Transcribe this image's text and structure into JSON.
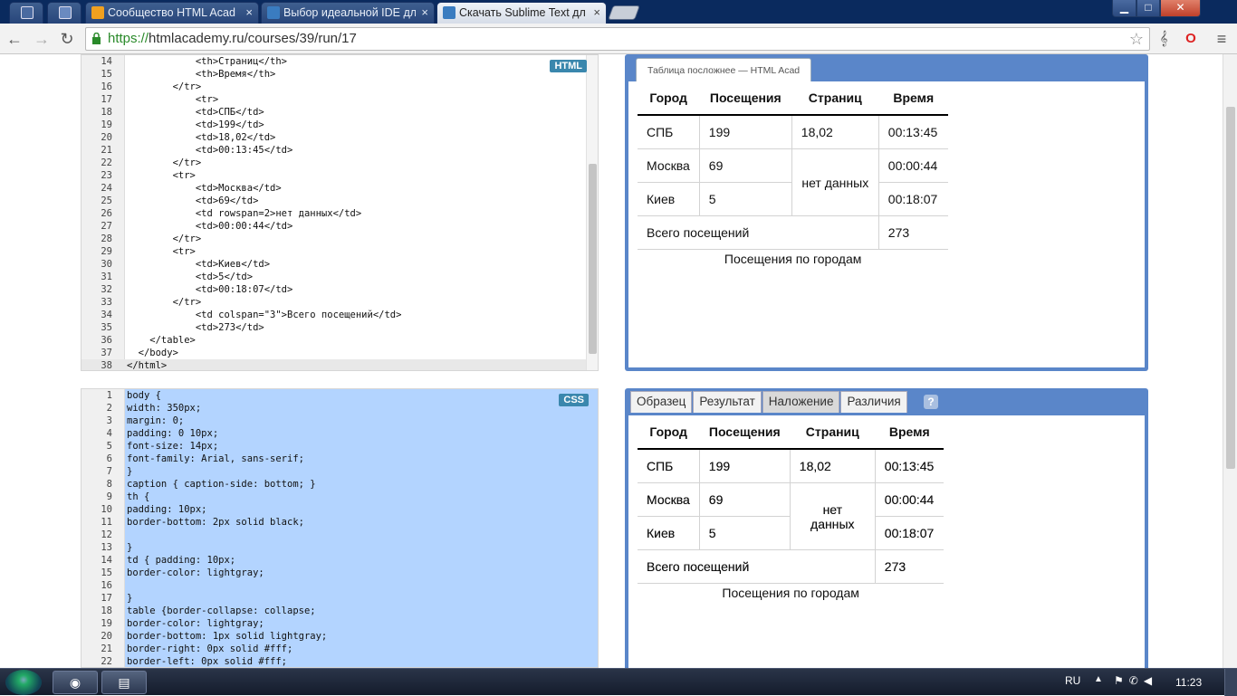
{
  "browser": {
    "tabs": [
      {
        "title": "Сообщество HTML Acad",
        "icon_color": "#f0a020"
      },
      {
        "title": "Выбор идеальной IDE дл",
        "icon_color": "#3a7cc0"
      },
      {
        "title": "Скачать Sublime Text дл",
        "icon_color": "#3a7cc0"
      }
    ],
    "close_glyph": "×",
    "window_controls": {
      "minimize": "▁",
      "maximize": "□",
      "close": "✕"
    },
    "url_scheme": "https://",
    "url_rest": "htmlacademy.ru/courses/39/run/17"
  },
  "html_editor": {
    "badge": "HTML",
    "lines": [
      {
        "n": "14",
        "code": "            <th>Страниц</th>"
      },
      {
        "n": "15",
        "code": "            <th>Время</th>"
      },
      {
        "n": "16",
        "code": "        </tr>"
      },
      {
        "n": "17",
        "code": "            <tr>"
      },
      {
        "n": "18",
        "code": "            <td>СПБ</td>"
      },
      {
        "n": "19",
        "code": "            <td>199</td>"
      },
      {
        "n": "20",
        "code": "            <td>18,02</td>"
      },
      {
        "n": "21",
        "code": "            <td>00:13:45</td>"
      },
      {
        "n": "22",
        "code": "        </tr>"
      },
      {
        "n": "23",
        "code": "        <tr>"
      },
      {
        "n": "24",
        "code": "            <td>Москва</td>"
      },
      {
        "n": "25",
        "code": "            <td>69</td>"
      },
      {
        "n": "26",
        "code": "            <td rowspan=2>нет данных</td>"
      },
      {
        "n": "27",
        "code": "            <td>00:00:44</td>"
      },
      {
        "n": "28",
        "code": "        </tr>"
      },
      {
        "n": "29",
        "code": "        <tr>"
      },
      {
        "n": "30",
        "code": "            <td>Киев</td>"
      },
      {
        "n": "31",
        "code": "            <td>5</td>"
      },
      {
        "n": "32",
        "code": "            <td>00:18:07</td>"
      },
      {
        "n": "33",
        "code": "        </tr>"
      },
      {
        "n": "34",
        "code": "            <td colspan=\"3\">Всего посещений</td>"
      },
      {
        "n": "35",
        "code": "            <td>273</td>"
      },
      {
        "n": "36",
        "code": "    </table>"
      },
      {
        "n": "37",
        "code": "  </body>"
      },
      {
        "n": "38",
        "code": "</html>"
      }
    ]
  },
  "css_editor": {
    "badge": "CSS",
    "lines": [
      {
        "n": "1",
        "code": "body {"
      },
      {
        "n": "2",
        "code": "width: 350px;"
      },
      {
        "n": "3",
        "code": "margin: 0;"
      },
      {
        "n": "4",
        "code": "padding: 0 10px;"
      },
      {
        "n": "5",
        "code": "font-size: 14px;"
      },
      {
        "n": "6",
        "code": "font-family: Arial, sans-serif;"
      },
      {
        "n": "7",
        "code": "}"
      },
      {
        "n": "8",
        "code": "caption { caption-side: bottom; }"
      },
      {
        "n": "9",
        "code": "th {"
      },
      {
        "n": "10",
        "code": "padding: 10px;"
      },
      {
        "n": "11",
        "code": "border-bottom: 2px solid black;"
      },
      {
        "n": "12",
        "code": ""
      },
      {
        "n": "13",
        "code": "}"
      },
      {
        "n": "14",
        "code": "td { padding: 10px;"
      },
      {
        "n": "15",
        "code": "border-color: lightgray;"
      },
      {
        "n": "16",
        "code": ""
      },
      {
        "n": "17",
        "code": "}"
      },
      {
        "n": "18",
        "code": "table {border-collapse: collapse;"
      },
      {
        "n": "19",
        "code": "border-color: lightgray;"
      },
      {
        "n": "20",
        "code": "border-bottom: 1px solid lightgray;"
      },
      {
        "n": "21",
        "code": "border-right: 0px solid #fff;"
      },
      {
        "n": "22",
        "code": "border-left: 0px solid #fff;"
      }
    ]
  },
  "preview": {
    "tab_title": "Таблица посложнее — HTML Acad",
    "mode_tabs": [
      "Образец",
      "Результат",
      "Наложение",
      "Различия"
    ],
    "active_mode": "Наложение",
    "help": "?",
    "table": {
      "headers": [
        "Город",
        "Посещения",
        "Страниц",
        "Время"
      ],
      "rows": {
        "spb": [
          "СПБ",
          "199",
          "18,02",
          "00:13:45"
        ],
        "msk": [
          "Москва",
          "69",
          "нет данных",
          "00:00:44"
        ],
        "kiev": [
          "Киев",
          "5",
          "00:18:07"
        ],
        "total": [
          "Всего посещений",
          "273"
        ]
      },
      "caption": "Посещения по городам"
    }
  },
  "taskbar": {
    "lang": "RU",
    "clock": "11:23"
  }
}
